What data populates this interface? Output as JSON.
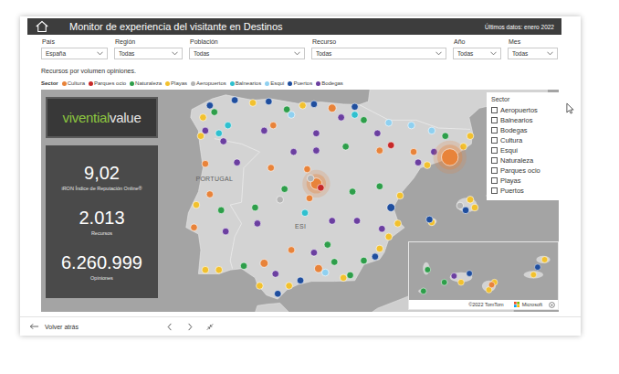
{
  "header": {
    "title": "Monitor de experiencia del visitante en Destinos",
    "updated": "Últimos datos: enero 2022"
  },
  "filters": [
    {
      "label": "País",
      "value": "España"
    },
    {
      "label": "Región",
      "value": "Todas"
    },
    {
      "label": "Población",
      "value": "Todas"
    },
    {
      "label": "Recurso",
      "value": "Todas"
    },
    {
      "label": "Año",
      "value": "Todas"
    },
    {
      "label": "Mes",
      "value": "Todas"
    }
  ],
  "chart": {
    "title": "Recursos por volumen opiniones.",
    "legend": {
      "title": "Sector",
      "items": [
        {
          "label": "Cultura",
          "color": "#e8833a"
        },
        {
          "label": "Parques ocio",
          "color": "#c62828"
        },
        {
          "label": "Naturaleza",
          "color": "#2e9e4a"
        },
        {
          "label": "Playas",
          "color": "#f2c12e"
        },
        {
          "label": "Aeropuertos",
          "color": "#b4b4b4"
        },
        {
          "label": "Balnearios",
          "color": "#2fc0cf"
        },
        {
          "label": "Esquí",
          "color": "#8fd0f0"
        },
        {
          "label": "Puertos",
          "color": "#1f4e9e"
        },
        {
          "label": "Bodegas",
          "color": "#6b3fa0"
        }
      ]
    }
  },
  "logo": {
    "parts": [
      "vivential",
      "value"
    ]
  },
  "stats": [
    {
      "value": "9,02",
      "label": "iRON Índice de Reputación Online®"
    },
    {
      "value": "2.013",
      "label": "Recursos"
    },
    {
      "value": "6.260.999",
      "label": "Opiniones"
    }
  ],
  "slicer": {
    "title": "Sector",
    "items": [
      {
        "label": "Aeropuertos",
        "checked": false
      },
      {
        "label": "Balnearios",
        "checked": false
      },
      {
        "label": "Bodegas",
        "checked": false
      },
      {
        "label": "Cultura",
        "checked": false
      },
      {
        "label": "Esquí",
        "checked": false
      },
      {
        "label": "Naturaleza",
        "checked": false
      },
      {
        "label": "Parques ocio",
        "checked": false
      },
      {
        "label": "Playas",
        "checked": false
      },
      {
        "label": "Puertos",
        "checked": false
      }
    ]
  },
  "map": {
    "labels": [
      {
        "text": "PORTUGAL",
        "lon": -8.2,
        "lat": 40.5
      },
      {
        "text": "ESI",
        "lon": -4.4,
        "lat": 38.7
      }
    ],
    "points": [
      {
        "lon": -8.4,
        "lat": 43.35,
        "sector": "Puertos",
        "level": 0.1
      },
      {
        "lon": -8.7,
        "lat": 42.9,
        "sector": "Playas",
        "level": 0.1
      },
      {
        "lon": -8.6,
        "lat": 42.4,
        "sector": "Bodegas",
        "level": 0.1
      },
      {
        "lon": -8.0,
        "lat": 42.3,
        "sector": "Balnearios",
        "level": 0.1
      },
      {
        "lon": -7.6,
        "lat": 42.6,
        "sector": "Balnearios",
        "level": 0.1
      },
      {
        "lon": -7.3,
        "lat": 43.55,
        "sector": "Puertos",
        "level": 0.1
      },
      {
        "lon": -8.2,
        "lat": 43.1,
        "sector": "Naturaleza",
        "level": 0.1
      },
      {
        "lon": -7.8,
        "lat": 42.0,
        "sector": "Bodegas",
        "level": 0.1
      },
      {
        "lon": -8.8,
        "lat": 42.2,
        "sector": "Playas",
        "level": 0.1
      },
      {
        "lon": -5.8,
        "lat": 43.5,
        "sector": "Puertos",
        "level": 0.1
      },
      {
        "lon": -6.5,
        "lat": 43.45,
        "sector": "Playas",
        "level": 0.1
      },
      {
        "lon": -5.0,
        "lat": 43.2,
        "sector": "Naturaleza",
        "level": 0.1
      },
      {
        "lon": -4.3,
        "lat": 43.35,
        "sector": "Playas",
        "level": 0.1
      },
      {
        "lon": -3.8,
        "lat": 43.4,
        "sector": "Puertos",
        "level": 0.1
      },
      {
        "lon": -4.8,
        "lat": 43.0,
        "sector": "Esquí",
        "level": 0.1
      },
      {
        "lon": -3.0,
        "lat": 43.25,
        "sector": "Cultura",
        "level": 0.2
      },
      {
        "lon": -2.0,
        "lat": 43.3,
        "sector": "Puertos",
        "level": 0.1
      },
      {
        "lon": -2.6,
        "lat": 42.9,
        "sector": "Bodegas",
        "level": 0.1
      },
      {
        "lon": -1.6,
        "lat": 42.8,
        "sector": "Naturaleza",
        "level": 0.1
      },
      {
        "lon": -0.5,
        "lat": 42.7,
        "sector": "Esquí",
        "level": 0.1
      },
      {
        "lon": 0.5,
        "lat": 42.6,
        "sector": "Esquí",
        "level": 0.1
      },
      {
        "lon": 1.4,
        "lat": 42.4,
        "sector": "Esquí",
        "level": 0.1
      },
      {
        "lon": 2.0,
        "lat": 42.2,
        "sector": "Naturaleza",
        "level": 0.1
      },
      {
        "lon": -1.0,
        "lat": 42.3,
        "sector": "Bodegas",
        "level": 0.1
      },
      {
        "lon": 3.1,
        "lat": 42.2,
        "sector": "Playas",
        "level": 0.1
      },
      {
        "lon": 2.8,
        "lat": 41.8,
        "sector": "Playas",
        "level": 0.1
      },
      {
        "lon": 1.2,
        "lat": 41.1,
        "sector": "Playas",
        "level": 0.1
      },
      {
        "lon": 1.5,
        "lat": 41.6,
        "sector": "Bodegas",
        "level": 0.1
      },
      {
        "lon": 0.6,
        "lat": 41.6,
        "sector": "Cultura",
        "level": 0.1
      },
      {
        "lon": 0.8,
        "lat": 41.2,
        "sector": "Bodegas",
        "level": 0.1
      },
      {
        "lon": -0.4,
        "lat": 39.5,
        "sector": "Puertos",
        "level": 0.2
      },
      {
        "lon": 0.0,
        "lat": 39.95,
        "sector": "Playas",
        "level": 0.1
      },
      {
        "lon": -0.1,
        "lat": 38.9,
        "sector": "Playas",
        "level": 0.1
      },
      {
        "lon": -0.5,
        "lat": 38.4,
        "sector": "Playas",
        "level": 0.1
      },
      {
        "lon": -0.8,
        "lat": 38.7,
        "sector": "Bodegas",
        "level": 0.1
      },
      {
        "lon": -1.1,
        "lat": 37.65,
        "sector": "Puertos",
        "level": 0.1
      },
      {
        "lon": -0.9,
        "lat": 37.95,
        "sector": "Playas",
        "level": 0.1
      },
      {
        "lon": -1.6,
        "lat": 37.5,
        "sector": "Naturaleza",
        "level": 0.1
      },
      {
        "lon": -2.5,
        "lat": 36.85,
        "sector": "Playas",
        "level": 0.1
      },
      {
        "lon": -3.6,
        "lat": 37.2,
        "sector": "Cultura",
        "level": 0.2
      },
      {
        "lon": -3.3,
        "lat": 37.05,
        "sector": "Esquí",
        "level": 0.1
      },
      {
        "lon": -4.4,
        "lat": 36.75,
        "sector": "Puertos",
        "level": 0.1
      },
      {
        "lon": -4.9,
        "lat": 36.55,
        "sector": "Playas",
        "level": 0.1
      },
      {
        "lon": -5.4,
        "lat": 36.25,
        "sector": "Puertos",
        "level": 0.1
      },
      {
        "lon": -6.2,
        "lat": 36.55,
        "sector": "Playas",
        "level": 0.1
      },
      {
        "lon": -6.0,
        "lat": 37.4,
        "sector": "Cultura",
        "level": 0.2
      },
      {
        "lon": -4.8,
        "lat": 37.9,
        "sector": "Cultura",
        "level": 0.1
      },
      {
        "lon": -3.8,
        "lat": 37.8,
        "sector": "Bodegas",
        "level": 0.1
      },
      {
        "lon": -6.9,
        "lat": 37.3,
        "sector": "Naturaleza",
        "level": 0.1
      },
      {
        "lon": -5.5,
        "lat": 37.0,
        "sector": "Bodegas",
        "level": 0.1
      },
      {
        "lon": -2.9,
        "lat": 37.45,
        "sector": "Naturaleza",
        "level": 0.1
      },
      {
        "lon": -2.2,
        "lat": 36.95,
        "sector": "Naturaleza",
        "level": 0.1
      },
      {
        "lon": -9.1,
        "lat": 38.75,
        "sector": "Cultura",
        "level": 0.1
      },
      {
        "lon": -8.6,
        "lat": 41.15,
        "sector": "Cultura",
        "level": 0.1
      },
      {
        "lon": -8.0,
        "lat": 37.15,
        "sector": "Playas",
        "level": 0.1
      },
      {
        "lon": -8.6,
        "lat": 37.15,
        "sector": "Playas",
        "level": 0.1
      },
      {
        "lon": -8.4,
        "lat": 40.0,
        "sector": "Cultura",
        "level": 0.1
      },
      {
        "lon": -7.9,
        "lat": 39.4,
        "sector": "Naturaleza",
        "level": 0.1
      },
      {
        "lon": -7.7,
        "lat": 38.6,
        "sector": "Bodegas",
        "level": 0.1
      },
      {
        "lon": -7.2,
        "lat": 41.2,
        "sector": "Bodegas",
        "level": 0.1
      },
      {
        "lon": -9.0,
        "lat": 39.6,
        "sector": "Playas",
        "level": 0.1
      },
      {
        "lon": 2.2,
        "lat": 41.4,
        "sector": "Cultura",
        "level": 1
      },
      {
        "lon": -3.7,
        "lat": 40.4,
        "sector": "Cultura",
        "level": 0.5
      },
      {
        "lon": -3.5,
        "lat": 40.25,
        "sector": "Parques ocio",
        "level": 0.1
      },
      {
        "lon": -3.95,
        "lat": 40.6,
        "sector": "Aeropuertos",
        "level": 0.1
      },
      {
        "lon": -4.1,
        "lat": 40.95,
        "sector": "Cultura",
        "level": 0.1
      },
      {
        "lon": -4.7,
        "lat": 41.6,
        "sector": "Bodegas",
        "level": 0.1
      },
      {
        "lon": -3.7,
        "lat": 41.65,
        "sector": "Bodegas",
        "level": 0.1
      },
      {
        "lon": -5.7,
        "lat": 41.0,
        "sector": "Cultura",
        "level": 0.1
      },
      {
        "lon": -5.6,
        "lat": 42.6,
        "sector": "Cultura",
        "level": 0.1
      },
      {
        "lon": -4.0,
        "lat": 39.85,
        "sector": "Cultura",
        "level": 0.1
      },
      {
        "lon": -3.0,
        "lat": 39.0,
        "sector": "Bodegas",
        "level": 0.1
      },
      {
        "lon": -2.1,
        "lat": 40.1,
        "sector": "Naturaleza",
        "level": 0.1
      },
      {
        "lon": -1.9,
        "lat": 39.0,
        "sector": "Bodegas",
        "level": 0.1
      },
      {
        "lon": -0.9,
        "lat": 41.65,
        "sector": "Cultura",
        "level": 0.1
      },
      {
        "lon": -0.9,
        "lat": 40.3,
        "sector": "Naturaleza",
        "level": 0.1
      },
      {
        "lon": -2.4,
        "lat": 41.8,
        "sector": "Naturaleza",
        "level": 0.1
      },
      {
        "lon": -6.4,
        "lat": 39.5,
        "sector": "Naturaleza",
        "level": 0.1
      },
      {
        "lon": -6.3,
        "lat": 38.9,
        "sector": "Bodegas",
        "level": 0.1
      },
      {
        "lon": -4.2,
        "lat": 39.3,
        "sector": "Balnearios",
        "level": 0.1
      },
      {
        "lon": -3.2,
        "lat": 38.1,
        "sector": "Naturaleza",
        "level": 0.1
      },
      {
        "lon": -5.1,
        "lat": 40.2,
        "sector": "Naturaleza",
        "level": 0.1
      },
      {
        "lon": -2.0,
        "lat": 43.0,
        "sector": "Balnearios",
        "level": 0.1
      },
      {
        "lon": -0.4,
        "lat": 41.85,
        "sector": "Parques ocio",
        "level": 0.1
      },
      {
        "lon": -6.0,
        "lat": 42.4,
        "sector": "Bodegas",
        "level": 0.1
      },
      {
        "lon": -3.7,
        "lat": 42.3,
        "sector": "Bodegas",
        "level": 0.1
      },
      {
        "lon": -5.3,
        "lat": 39.8,
        "sector": "Aeropuertos",
        "level": 0.1
      },
      {
        "lon": 2.65,
        "lat": 39.57,
        "sector": "Aeropuertos",
        "level": 0.1
      },
      {
        "lon": 3.1,
        "lat": 39.8,
        "sector": "Playas",
        "level": 0.1
      },
      {
        "lon": 3.3,
        "lat": 39.5,
        "sector": "Playas",
        "level": 0.1
      },
      {
        "lon": 2.9,
        "lat": 39.4,
        "sector": "Puertos",
        "level": 0.1
      },
      {
        "lon": 1.4,
        "lat": 38.95,
        "sector": "Playas",
        "level": 0.1
      },
      {
        "lon": 4.1,
        "lat": 39.95,
        "sector": "Playas",
        "level": 0.1
      },
      {
        "lon": 1.3,
        "lat": 39.05,
        "sector": "Puertos",
        "level": 0.1
      }
    ]
  },
  "inset": {
    "points": [
      {
        "lon": -15.4,
        "lat": 28.1,
        "sector": "Playas",
        "level": 0.1
      },
      {
        "lon": -15.6,
        "lat": 27.8,
        "sector": "Playas",
        "level": 0.1
      },
      {
        "lon": -16.3,
        "lat": 28.45,
        "sector": "Puertos",
        "level": 0.1
      },
      {
        "lon": -16.6,
        "lat": 28.1,
        "sector": "Playas",
        "level": 0.1
      },
      {
        "lon": -16.85,
        "lat": 28.35,
        "sector": "Bodegas",
        "level": 0.1
      },
      {
        "lon": -13.6,
        "lat": 29.0,
        "sector": "Playas",
        "level": 0.1
      },
      {
        "lon": -14.0,
        "lat": 28.4,
        "sector": "Playas",
        "level": 0.1
      },
      {
        "lon": -13.85,
        "lat": 28.7,
        "sector": "Puertos",
        "level": 0.1
      },
      {
        "lon": -17.8,
        "lat": 28.6,
        "sector": "Naturaleza",
        "level": 0.1
      },
      {
        "lon": -17.2,
        "lat": 28.1,
        "sector": "Naturaleza",
        "level": 0.1
      },
      {
        "lon": -17.95,
        "lat": 27.75,
        "sector": "Naturaleza",
        "level": 0.1
      },
      {
        "lon": -15.5,
        "lat": 28.0,
        "sector": "Cultura",
        "level": 0.1
      }
    ],
    "attribution": "©2022 TomTom",
    "brand": "Microsoft"
  },
  "footer": {
    "back": "Volver atrás"
  }
}
